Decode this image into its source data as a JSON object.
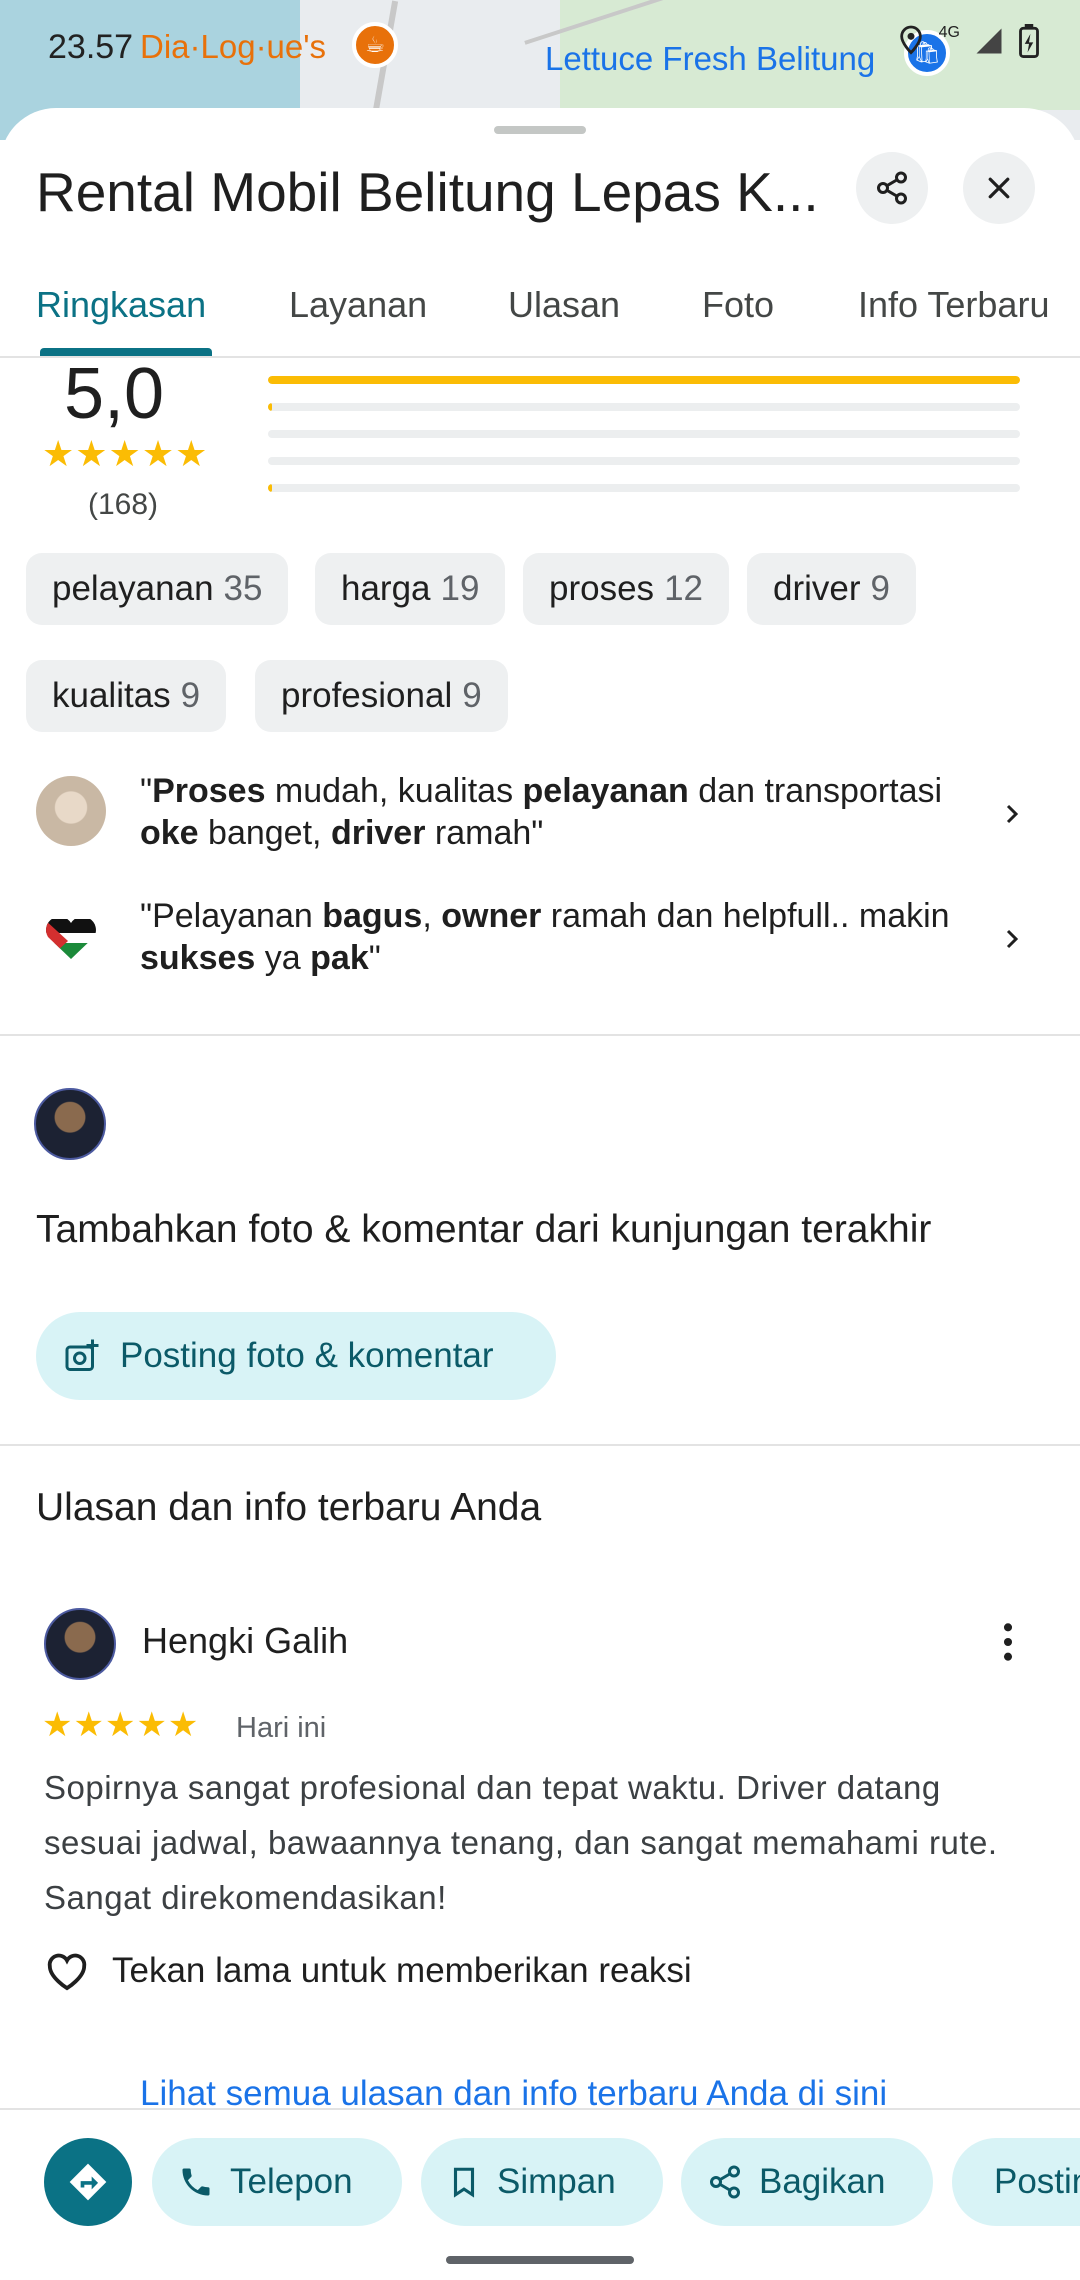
{
  "status_bar": {
    "time": "23.57",
    "network": "4G"
  },
  "map": {
    "label_left": "Dia·Log·ue's",
    "label_right": "Lettuce Fresh Belitung"
  },
  "place": {
    "title": "Rental Mobil Belitung Lepas K..."
  },
  "tabs": [
    {
      "label": "Ringkasan",
      "active": true
    },
    {
      "label": "Layanan",
      "active": false
    },
    {
      "label": "Ulasan",
      "active": false
    },
    {
      "label": "Foto",
      "active": false
    },
    {
      "label": "Info Terbaru",
      "active": false
    }
  ],
  "rating": {
    "score": "5,0",
    "stars": "★★★★★",
    "count": "(168)",
    "distribution": [
      {
        "stars": 5,
        "fraction": 1.0
      },
      {
        "stars": 4,
        "fraction": 0.006
      },
      {
        "stars": 3,
        "fraction": 0.0
      },
      {
        "stars": 2,
        "fraction": 0.0
      },
      {
        "stars": 1,
        "fraction": 0.006
      }
    ]
  },
  "chips": [
    {
      "label": "pelayanan",
      "count": "35"
    },
    {
      "label": "harga",
      "count": "19"
    },
    {
      "label": "proses",
      "count": "12"
    },
    {
      "label": "driver",
      "count": "9"
    },
    {
      "label": "kualitas",
      "count": "9"
    },
    {
      "label": "profesional",
      "count": "9"
    }
  ],
  "quotes": [
    {
      "parts": [
        "\"",
        "Proses",
        " mudah, kualitas ",
        "pelayanan",
        " dan transportasi ",
        "oke",
        " banget, ",
        "driver",
        " ramah\""
      ]
    },
    {
      "parts": [
        "\"Pelayanan ",
        "bagus",
        ", ",
        "owner",
        " ramah dan helpfull.. makin ",
        "sukses",
        " ya ",
        "pak",
        "\""
      ]
    }
  ],
  "contribute": {
    "heading": "Tambahkan foto & komentar dari kunjungan terakhir",
    "button_label": "Posting foto & komentar"
  },
  "your_reviews": {
    "heading": "Ulasan dan info terbaru Anda",
    "reviewer": "Hengki Galih",
    "stars": "★★★★★",
    "date": "Hari ini",
    "text": "Sopirnya sangat profesional dan tepat waktu. Driver datang sesuai jadwal, bawaannya tenang, dan sangat memahami rute. Sangat direkomendasikan!",
    "reaction_label": "Tekan lama untuk memberikan reaksi",
    "see_all": "Lihat semua ulasan dan info terbaru Anda di sini"
  },
  "actions": {
    "call": "Telepon",
    "save": "Simpan",
    "share": "Bagikan",
    "post": "Posting"
  },
  "colors": {
    "accent": "#0b7285",
    "star": "#fbbc04",
    "chip_bg": "#eef0f1",
    "pill_bg": "#d8f3f6",
    "link": "#1a73e8"
  }
}
